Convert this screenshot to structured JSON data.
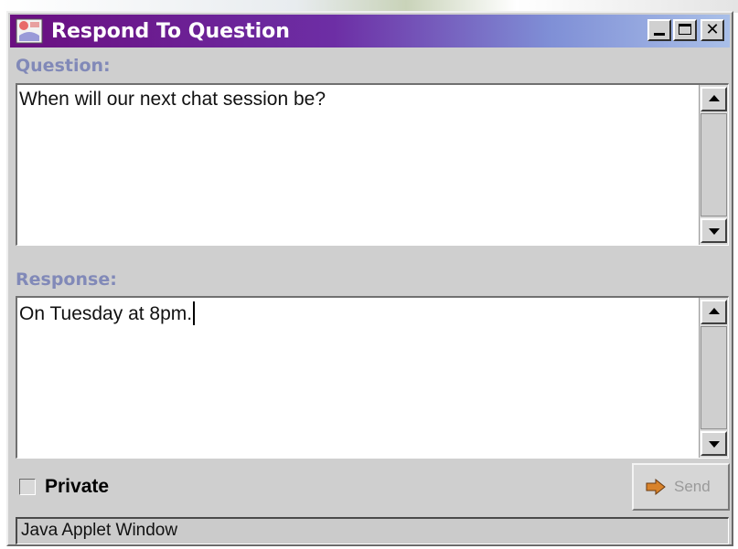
{
  "window": {
    "title": "Respond To Question",
    "controls": {
      "minimize": "minimize-icon",
      "maximize": "maximize-icon",
      "close": "✕"
    }
  },
  "question": {
    "label": "Question:",
    "text": "When will our next chat session be?"
  },
  "response": {
    "label": "Response:",
    "text": "On Tuesday at 8pm."
  },
  "private": {
    "label": "Private",
    "checked": false
  },
  "send_button": {
    "label": "Send",
    "icon": "arrow-right-icon",
    "enabled": false
  },
  "status_bar": {
    "text": "Java Applet Window"
  },
  "colors": {
    "title_gradient_start": "#6a0f80",
    "title_gradient_end": "#a9bfe8",
    "section_label": "#8189b8",
    "window_background": "#cfcfcf"
  }
}
